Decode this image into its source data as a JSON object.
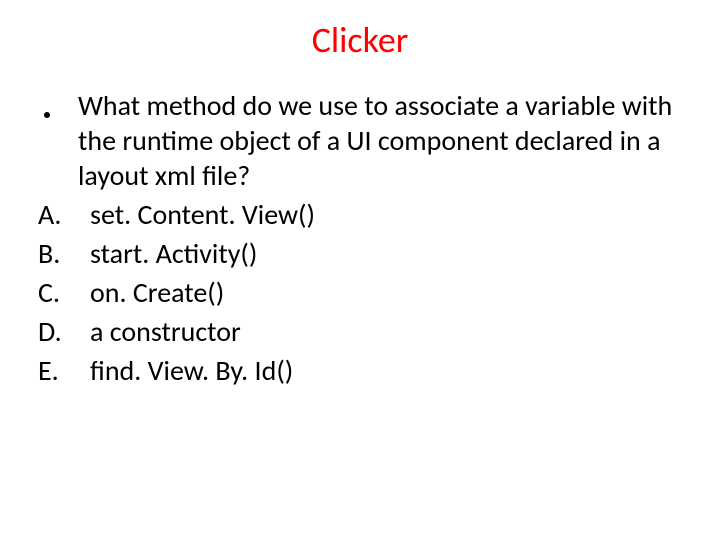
{
  "title": "Clicker",
  "question": "What method do we use to associate a variable with the runtime object of a UI component declared in a layout xml file?",
  "options": [
    {
      "letter": "A.",
      "text": "set. Content. View()"
    },
    {
      "letter": "B.",
      "text": "start. Activity()"
    },
    {
      "letter": "C.",
      "text": "on. Create()"
    },
    {
      "letter": "D.",
      "text": "a constructor"
    },
    {
      "letter": "E.",
      "text": "find. View. By. Id()"
    }
  ]
}
